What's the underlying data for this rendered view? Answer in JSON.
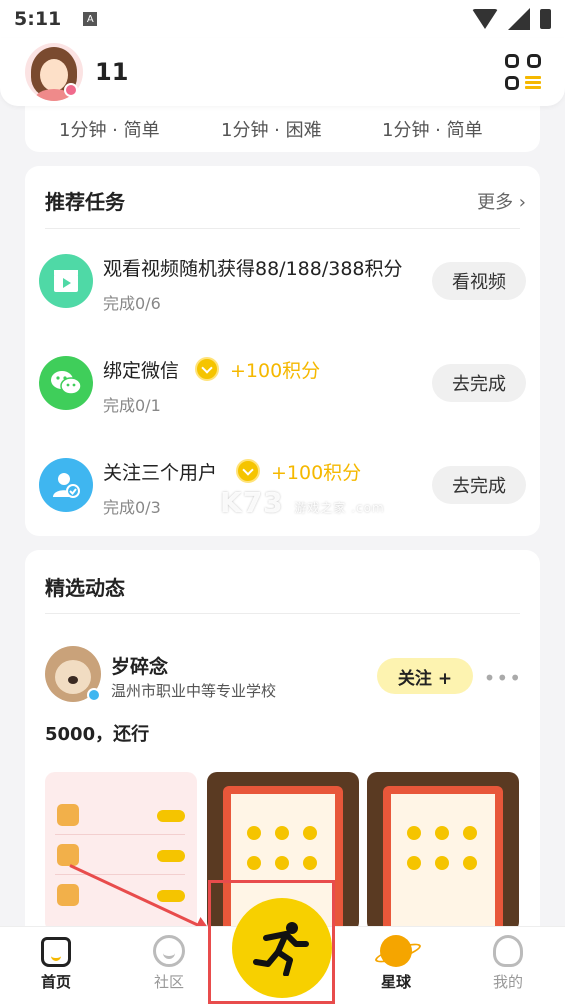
{
  "status_bar": {
    "time": "5:11",
    "notification_icon": "A"
  },
  "header": {
    "username": "11"
  },
  "top_partial": {
    "items": [
      "1分钟 · 简单",
      "1分钟 · 困难",
      "1分钟 · 简单"
    ]
  },
  "tasks_card": {
    "title": "推荐任务",
    "more_label": "更多 ›",
    "tasks": [
      {
        "title": "观看视频随机获得88/188/388积分",
        "progress": "完成0/6",
        "button": "看视频",
        "reward": "",
        "icon": "video-icon",
        "color": "#4fd9a6"
      },
      {
        "title": "绑定微信",
        "progress": "完成0/1",
        "button": "去完成",
        "reward": "+100积分",
        "icon": "wechat-icon",
        "color": "#3fce5a"
      },
      {
        "title": "关注三个用户",
        "progress": "完成0/3",
        "button": "去完成",
        "reward": "+100积分",
        "icon": "add-user-icon",
        "color": "#3fb6f0"
      }
    ]
  },
  "feed_card": {
    "title": "精选动态",
    "post": {
      "author": "岁碎念",
      "school": "温州市职业中等专业学校",
      "follow_label": "关注 +",
      "text": "5000，还行"
    }
  },
  "watermark": {
    "text": "K73",
    "sub": "游戏之家 .com"
  },
  "nav": {
    "items": [
      {
        "label": "首页",
        "active": true
      },
      {
        "label": "社区",
        "active": false
      },
      {
        "label": "星球",
        "active": true
      },
      {
        "label": "我的",
        "active": false
      }
    ]
  },
  "colors": {
    "accent": "#f5c400",
    "highlight": "#e84c4c"
  }
}
